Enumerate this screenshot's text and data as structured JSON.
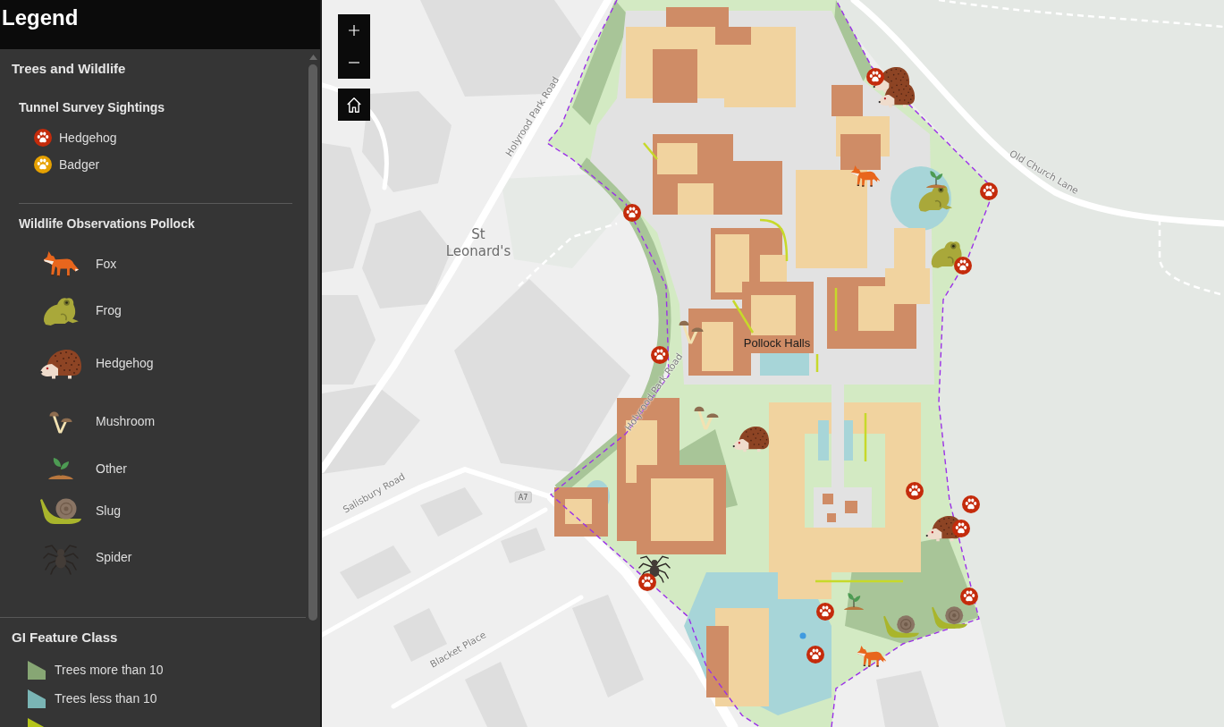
{
  "legend": {
    "title": "Legend",
    "layers": [
      {
        "title": "Trees and Wildlife",
        "groups": [
          {
            "title": "Tunnel Survey Sightings",
            "items": [
              {
                "kind": "paw",
                "label": "Hedgehog",
                "color": "#c42b0b"
              },
              {
                "kind": "paw",
                "label": "Badger",
                "color": "#e6a100"
              }
            ]
          },
          {
            "title": "Wildlife Observations Pollock",
            "items": [
              {
                "kind": "fox",
                "label": "Fox"
              },
              {
                "kind": "frog",
                "label": "Frog"
              },
              {
                "kind": "hedgehog",
                "label": "Hedgehog"
              },
              {
                "kind": "mushroom",
                "label": "Mushroom"
              },
              {
                "kind": "other",
                "label": "Other"
              },
              {
                "kind": "slug",
                "label": "Slug"
              },
              {
                "kind": "spider",
                "label": "Spider"
              }
            ]
          }
        ]
      },
      {
        "title": "GI Feature Class",
        "items": [
          {
            "kind": "swatch",
            "label": "Trees more than 10",
            "color": "#87a674"
          },
          {
            "kind": "swatch",
            "label": "Trees less than 10",
            "color": "#7ab5b5"
          },
          {
            "kind": "swatch",
            "color": "#b4c41a"
          }
        ]
      }
    ]
  },
  "map": {
    "controls": [
      {
        "kind": "zoom_in"
      },
      {
        "kind": "zoom_out"
      },
      {
        "kind": "home"
      }
    ],
    "labels": [
      {
        "kind": "road",
        "text": "Holyrood Park Road"
      },
      {
        "kind": "road",
        "text": "Old Church Lane"
      },
      {
        "kind": "place",
        "text": "St Leonard's"
      },
      {
        "kind": "area",
        "text": "Pollock Halls"
      },
      {
        "kind": "road",
        "text": "Holyrood Park Road"
      },
      {
        "kind": "road",
        "text": "Salisbury Road"
      },
      {
        "kind": "shield",
        "text": "A7"
      },
      {
        "kind": "road",
        "text": "Blacket Place"
      }
    ],
    "markers": [
      {
        "kind": "hedgehog"
      },
      {
        "kind": "hedgehog"
      },
      {
        "kind": "fox"
      },
      {
        "kind": "frog"
      },
      {
        "kind": "other"
      },
      {
        "kind": "frog"
      },
      {
        "kind": "mushroom"
      },
      {
        "kind": "mushroom"
      },
      {
        "kind": "hedgehog"
      },
      {
        "kind": "hedgehog"
      },
      {
        "kind": "spider"
      },
      {
        "kind": "other"
      },
      {
        "kind": "slug"
      },
      {
        "kind": "slug"
      },
      {
        "kind": "fox"
      },
      {
        "kind": "paw",
        "color": "#c42b0b"
      },
      {
        "kind": "paw",
        "color": "#c42b0b"
      },
      {
        "kind": "paw",
        "color": "#c42b0b"
      },
      {
        "kind": "paw",
        "color": "#c42b0b"
      },
      {
        "kind": "paw",
        "color": "#c42b0b"
      },
      {
        "kind": "paw",
        "color": "#c42b0b"
      },
      {
        "kind": "paw",
        "color": "#c42b0b"
      },
      {
        "kind": "paw",
        "color": "#c42b0b"
      },
      {
        "kind": "paw",
        "color": "#c42b0b"
      },
      {
        "kind": "paw",
        "color": "#c42b0b"
      },
      {
        "kind": "paw",
        "color": "#c42b0b"
      },
      {
        "kind": "paw",
        "color": "#c42b0b"
      }
    ]
  }
}
